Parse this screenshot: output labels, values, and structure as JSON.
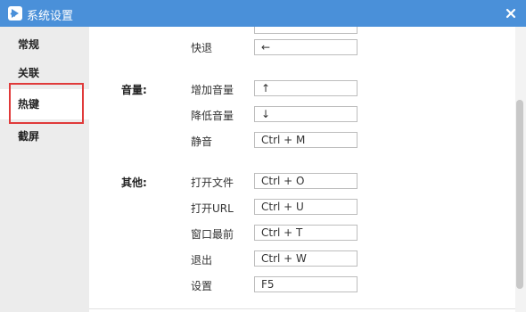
{
  "window": {
    "title": "系统设置",
    "accent": "#4a90d9"
  },
  "sidebar": {
    "items": [
      {
        "label": "常规"
      },
      {
        "label": "关联"
      },
      {
        "label": "热键"
      },
      {
        "label": "截屏"
      }
    ],
    "active_index": 2,
    "highlight_color": "#e03a3a"
  },
  "playback": {
    "rows": [
      {
        "label": "快退",
        "value": "←"
      }
    ]
  },
  "volume": {
    "title": "音量:",
    "rows": [
      {
        "label": "增加音量",
        "value": "↑"
      },
      {
        "label": "降低音量",
        "value": "↓"
      },
      {
        "label": "静音",
        "value": "Ctrl + M"
      }
    ]
  },
  "other": {
    "title": "其他:",
    "rows": [
      {
        "label": "打开文件",
        "value": "Ctrl + O"
      },
      {
        "label": "打开URL",
        "value": "Ctrl + U"
      },
      {
        "label": "窗口最前",
        "value": "Ctrl + T"
      },
      {
        "label": "退出",
        "value": "Ctrl + W"
      },
      {
        "label": "设置",
        "value": "F5"
      }
    ]
  },
  "icons": {
    "app": "app-logo-icon",
    "close": "close-icon"
  }
}
